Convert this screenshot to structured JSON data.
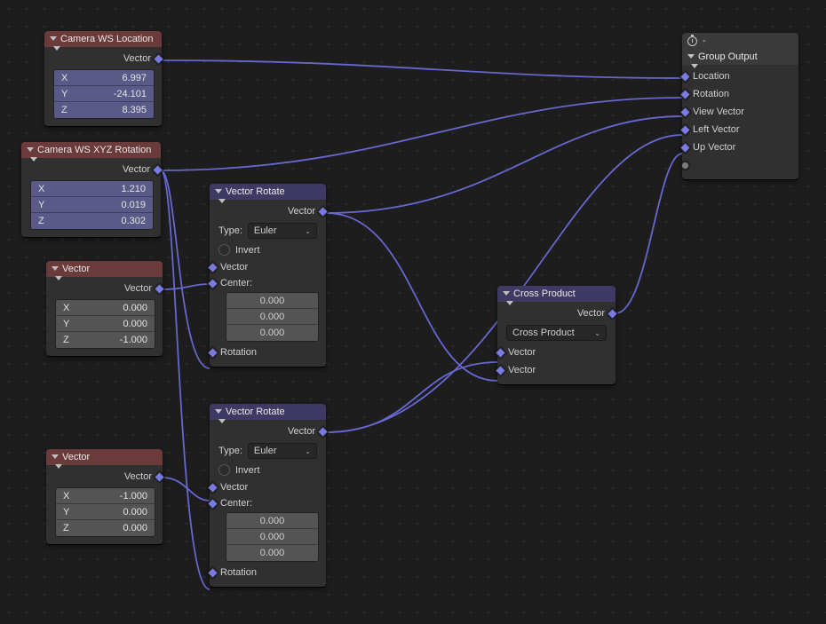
{
  "nodes": {
    "camLoc": {
      "title": "Camera WS Location",
      "out": "Vector",
      "x": "X",
      "y": "Y",
      "z": "Z",
      "xv": "6.997",
      "yv": "-24.101",
      "zv": "8.395"
    },
    "camRot": {
      "title": "Camera WS XYZ Rotation",
      "out": "Vector",
      "x": "X",
      "y": "Y",
      "z": "Z",
      "xv": "1.210",
      "yv": "0.019",
      "zv": "0.302"
    },
    "vecA": {
      "title": "Vector",
      "out": "Vector",
      "x": "X",
      "y": "Y",
      "z": "Z",
      "xv": "0.000",
      "yv": "0.000",
      "zv": "-1.000"
    },
    "vecB": {
      "title": "Vector",
      "out": "Vector",
      "x": "X",
      "y": "Y",
      "z": "Z",
      "xv": "-1.000",
      "yv": "0.000",
      "zv": "0.000"
    },
    "rot1": {
      "title": "Vector Rotate",
      "out": "Vector",
      "typeLabel": "Type:",
      "typeValue": "Euler",
      "invert": "Invert",
      "vecIn": "Vector",
      "centerLabel": "Center:",
      "c1": "0.000",
      "c2": "0.000",
      "c3": "0.000",
      "rotIn": "Rotation"
    },
    "rot2": {
      "title": "Vector Rotate",
      "out": "Vector",
      "typeLabel": "Type:",
      "typeValue": "Euler",
      "invert": "Invert",
      "vecIn": "Vector",
      "centerLabel": "Center:",
      "c1": "0.000",
      "c2": "0.000",
      "c3": "0.000",
      "rotIn": "Rotation"
    },
    "cross": {
      "title": "Cross Product",
      "out": "Vector",
      "op": "Cross Product",
      "inA": "Vector",
      "inB": "Vector"
    },
    "group": {
      "topbar": "-",
      "title": "Group Output",
      "loc": "Location",
      "rot": "Rotation",
      "view": "View Vector",
      "left": "Left Vector",
      "up": "Up Vector"
    }
  }
}
